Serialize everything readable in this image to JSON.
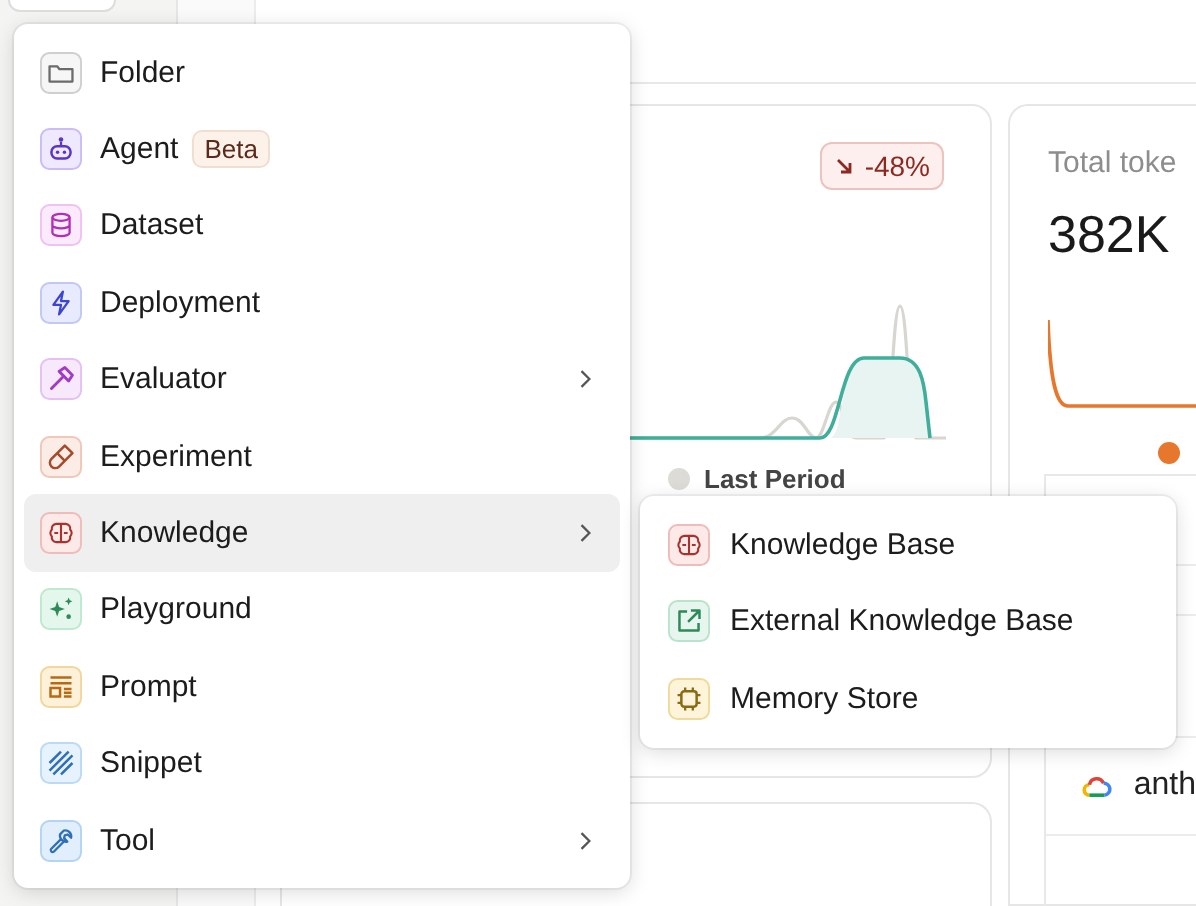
{
  "menu": {
    "items": [
      {
        "label": "Folder",
        "selected": false,
        "submenu": false
      },
      {
        "label": "Agent",
        "badge": "Beta",
        "selected": false,
        "submenu": false
      },
      {
        "label": "Dataset",
        "selected": false,
        "submenu": false
      },
      {
        "label": "Deployment",
        "selected": false,
        "submenu": false
      },
      {
        "label": "Evaluator",
        "selected": false,
        "submenu": true
      },
      {
        "label": "Experiment",
        "selected": false,
        "submenu": false
      },
      {
        "label": "Knowledge",
        "selected": true,
        "submenu": true
      },
      {
        "label": "Playground",
        "selected": false,
        "submenu": false
      },
      {
        "label": "Prompt",
        "selected": false,
        "submenu": false
      },
      {
        "label": "Snippet",
        "selected": false,
        "submenu": false
      },
      {
        "label": "Tool",
        "selected": false,
        "submenu": true
      }
    ]
  },
  "submenu": {
    "items": [
      {
        "label": "Knowledge Base"
      },
      {
        "label": "External Knowledge Base"
      },
      {
        "label": "Memory Store"
      }
    ]
  },
  "dashboard": {
    "cards": [
      {
        "change": "-48%",
        "legend": "Last Period"
      },
      {
        "title": "Total toke",
        "value": "382K"
      }
    ],
    "table": {
      "rows": [
        {
          "model": "anth"
        }
      ]
    }
  }
}
